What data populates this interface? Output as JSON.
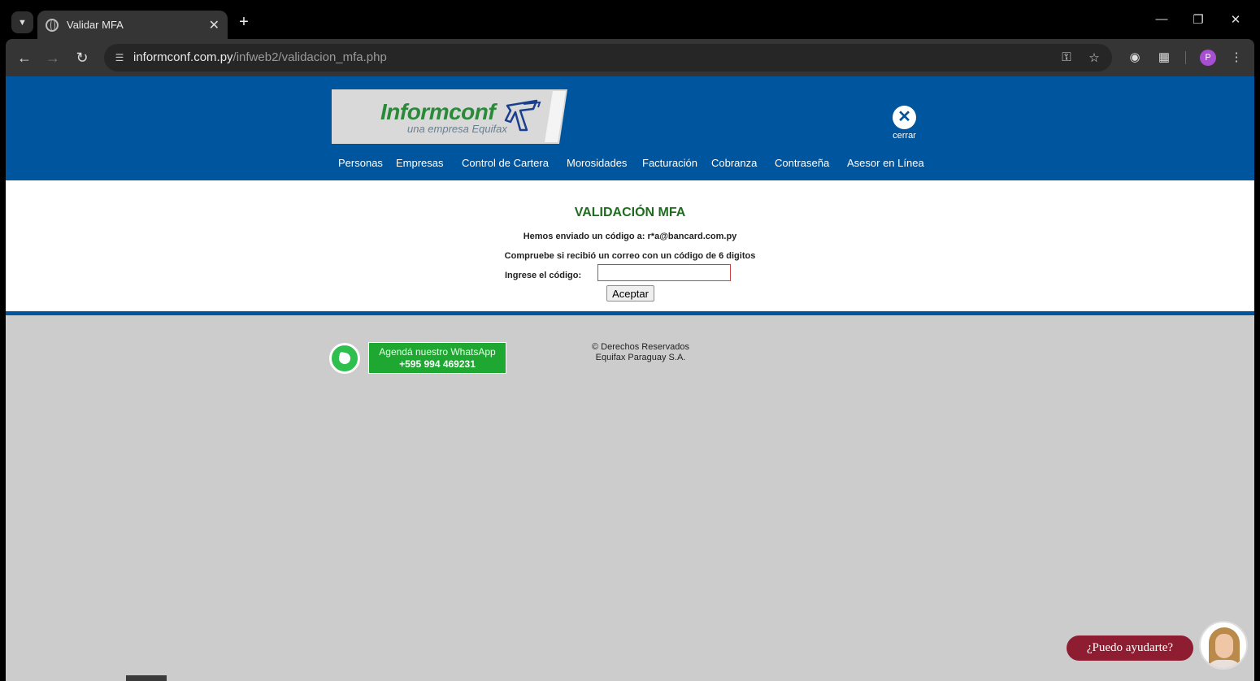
{
  "browser": {
    "tab_title": "Validar MFA",
    "new_tab_icon": "plus-icon",
    "url_domain": "informconf.com.py",
    "url_path": "/infweb2/validacion_mfa.php"
  },
  "header": {
    "logo_name": "Informconf",
    "logo_sub": "una empresa Equifax",
    "close_label": "cerrar",
    "menu": [
      "Personas",
      "Empresas",
      "Control de Cartera",
      "Morosidades",
      "Facturación",
      "Cobranza",
      "Contraseña",
      "Asesor en Línea"
    ]
  },
  "mfa": {
    "title": "VALIDACIÓN MFA",
    "sent_line": "Hemos enviado un código a: r*a@bancard.com.py",
    "check_line": "Compruebe si recibió un correo con un código de 6 digitos",
    "code_label": "Ingrese el código:",
    "code_value": "",
    "accept_label": "Aceptar"
  },
  "footer": {
    "whatsapp_line1": "Agendá nuestro WhatsApp",
    "whatsapp_line2": "+595 994 469231",
    "copyright_line1": "© Derechos Reservados",
    "copyright_line2": "Equifax Paraguay S.A."
  },
  "chat": {
    "bubble": "¿Puedo ayudarte?"
  },
  "colors": {
    "header_blue": "#00569e",
    "title_green": "#1f6b1f",
    "whatsapp_green": "#1ea832",
    "chat_red": "#8f1d32"
  }
}
